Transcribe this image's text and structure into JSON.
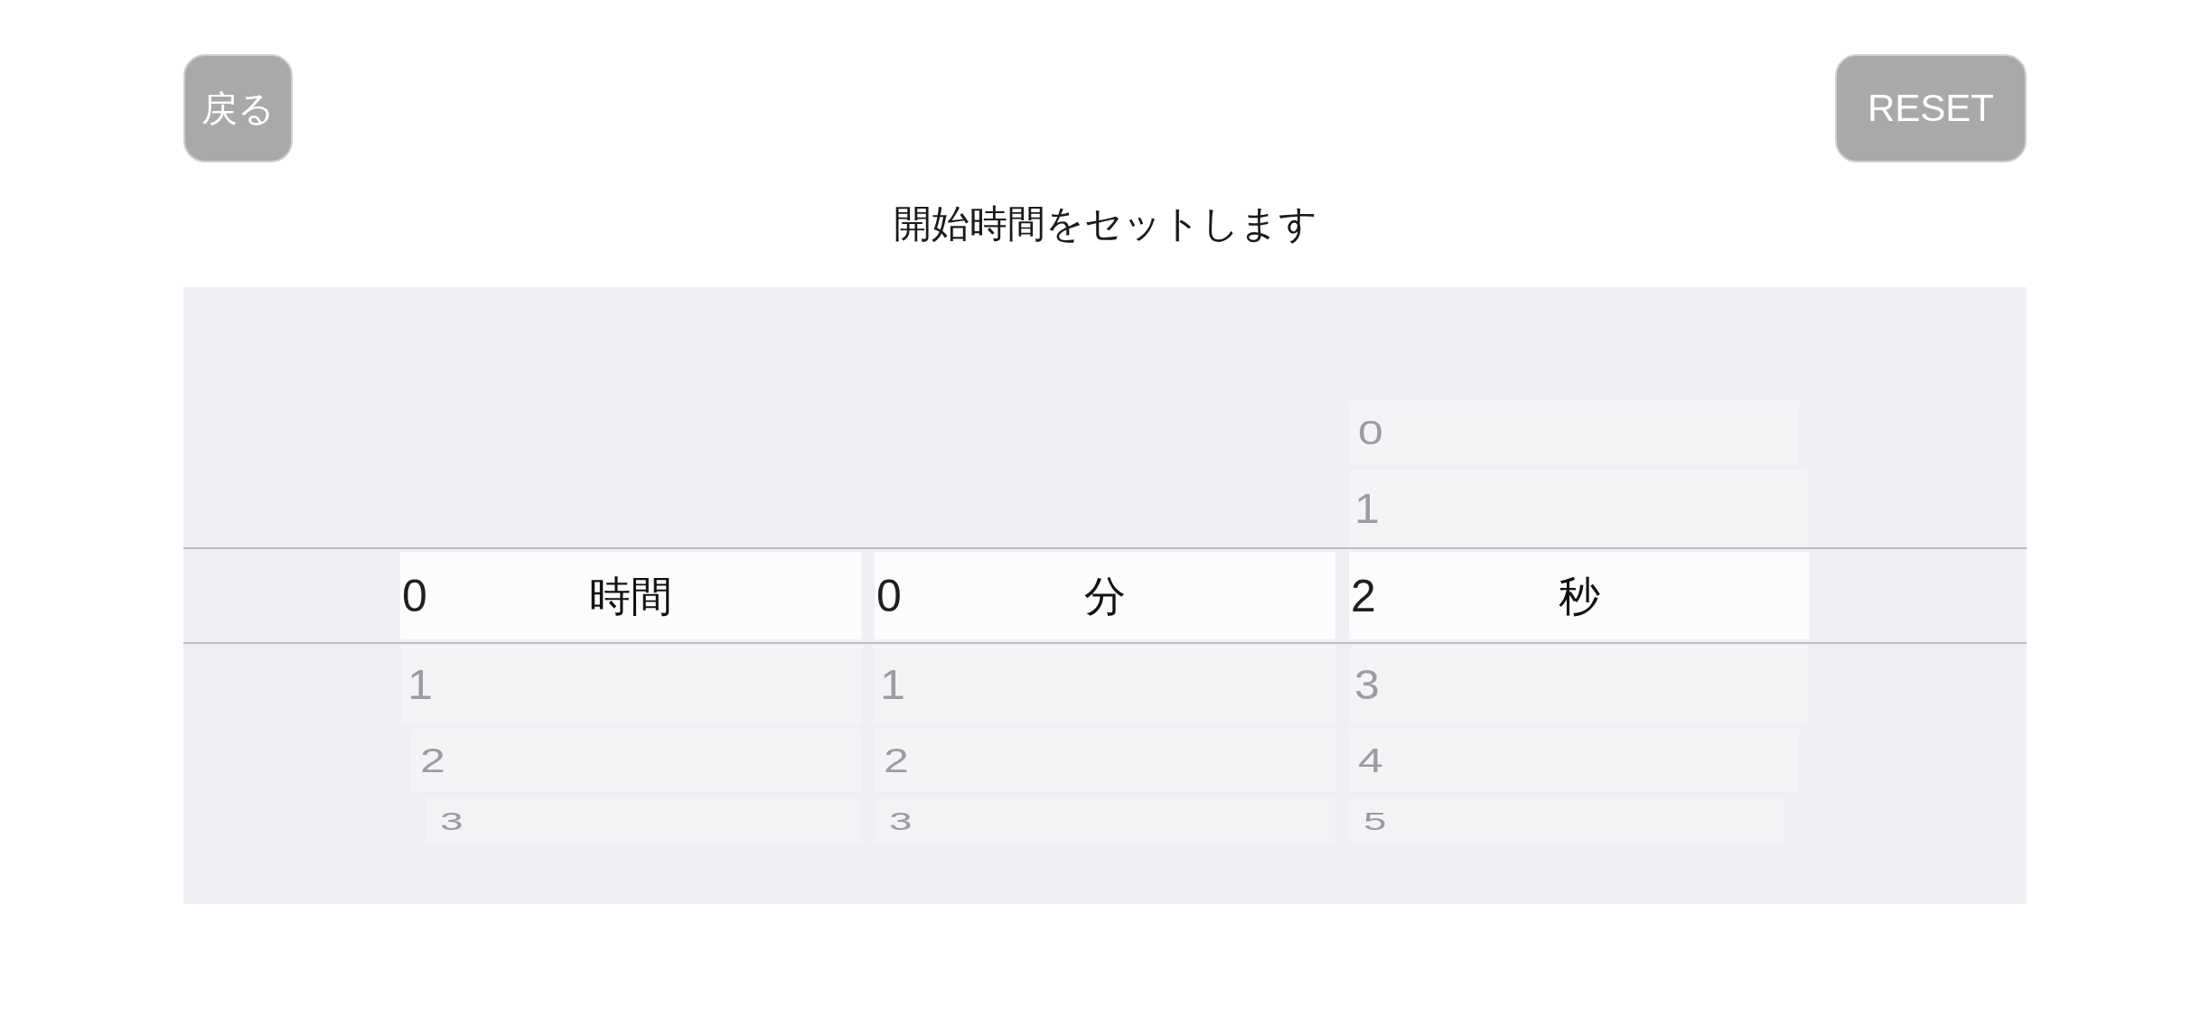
{
  "back_button": {
    "label": "戻る"
  },
  "reset_button": {
    "label": "RESET"
  },
  "title": "開始時間をセットします",
  "picker": {
    "columns": [
      {
        "unit": "時間",
        "options": [
          {
            "label": "0",
            "selected": true
          },
          {
            "label": "1",
            "selected": false
          },
          {
            "label": "2",
            "selected": false
          },
          {
            "label": "3",
            "selected": false
          }
        ]
      },
      {
        "unit": "分",
        "options": [
          {
            "label": "0",
            "selected": true
          },
          {
            "label": "1",
            "selected": false
          },
          {
            "label": "2",
            "selected": false
          },
          {
            "label": "3",
            "selected": false
          }
        ]
      },
      {
        "unit": "秒",
        "options": [
          {
            "label": "0",
            "selected": false
          },
          {
            "label": "1",
            "selected": false
          },
          {
            "label": "2",
            "selected": true
          },
          {
            "label": "3",
            "selected": false
          },
          {
            "label": "4",
            "selected": false
          },
          {
            "label": "5",
            "selected": false
          }
        ]
      }
    ]
  }
}
